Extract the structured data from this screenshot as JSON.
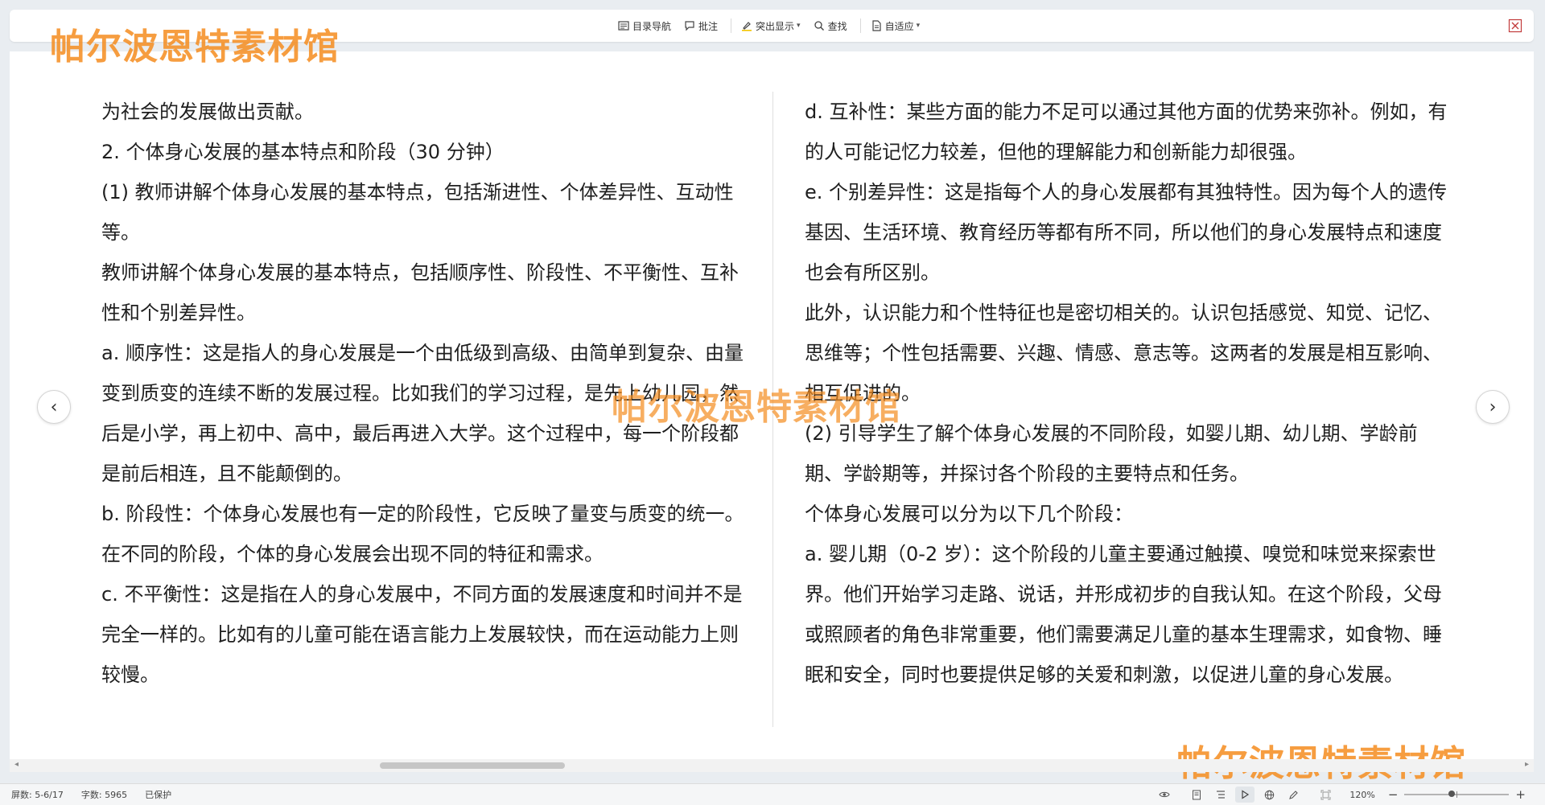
{
  "toolbar": {
    "items": [
      {
        "icon": "table-of-contents-icon",
        "label": "目录导航"
      },
      {
        "icon": "comment-icon",
        "label": "批注"
      },
      {
        "icon": "highlighter-icon",
        "label": "突出显示"
      },
      {
        "icon": "search-icon",
        "label": "查找"
      },
      {
        "icon": "page-fit-icon",
        "label": "自适应"
      }
    ],
    "close_icon": "close-icon"
  },
  "watermark": {
    "text": "帕尔波恩特素材馆",
    "color": "#f48c1e"
  },
  "document": {
    "left_page": [
      "为社会的发展做出贡献。",
      "2. 个体身心发展的基本特点和阶段（30 分钟）",
      "(1) 教师讲解个体身心发展的基本特点，包括渐进性、个体差异性、互动性等。",
      "教师讲解个体身心发展的基本特点，包括顺序性、阶段性、不平衡性、互补性和个别差异性。",
      "a. 顺序性：这是指人的身心发展是一个由低级到高级、由简单到复杂、由量变到质变的连续不断的发展过程。比如我们的学习过程，是先上幼儿园，然后是小学，再上初中、高中，最后再进入大学。这个过程中，每一个阶段都是前后相连，且不能颠倒的。",
      "b. 阶段性：个体身心发展也有一定的阶段性，它反映了量变与质变的统一。在不同的阶段，个体的身心发展会出现不同的特征和需求。",
      "c. 不平衡性：这是指在人的身心发展中，不同方面的发展速度和时间并不是完全一样的。比如有的儿童可能在语言能力上发展较快，而在运动能力上则较慢。"
    ],
    "right_page": [
      "d. 互补性：某些方面的能力不足可以通过其他方面的优势来弥补。例如，有的人可能记忆力较差，但他的理解能力和创新能力却很强。",
      "e. 个别差异性：这是指每个人的身心发展都有其独特性。因为每个人的遗传基因、生活环境、教育经历等都有所不同，所以他们的身心发展特点和速度也会有所区别。",
      "此外，认识能力和个性特征也是密切相关的。认识包括感觉、知觉、记忆、思维等；个性包括需要、兴趣、情感、意志等。这两者的发展是相互影响、相互促进的。",
      "(2) 引导学生了解个体身心发展的不同阶段，如婴儿期、幼儿期、学龄前期、学龄期等，并探讨各个阶段的主要特点和任务。",
      "个体身心发展可以分为以下几个阶段：",
      "a. 婴儿期（0-2 岁）：这个阶段的儿童主要通过触摸、嗅觉和味觉来探索世界。他们开始学习走路、说话，并形成初步的自我认知。在这个阶段，父母或照顾者的角色非常重要，他们需要满足儿童的基本生理需求，如食物、睡眠和安全，同时也要提供足够的关爱和刺激，以促进儿童的身心发展。"
    ]
  },
  "navigation": {
    "prev_icon": "chevron-left-icon",
    "next_icon": "chevron-right-icon"
  },
  "statusbar": {
    "pages": "屏数: 5-6/17",
    "word_count": "字数: 5965",
    "protection": "已保护",
    "zoom": "120%",
    "zoom_minus": "−",
    "zoom_plus": "+",
    "zoom_level_fraction": 0.45
  }
}
